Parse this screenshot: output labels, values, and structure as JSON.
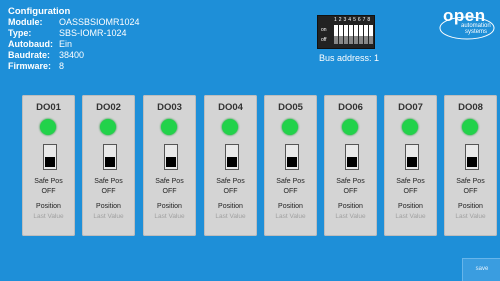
{
  "config": {
    "title": "Configuration",
    "rows": [
      {
        "key": "Module:",
        "value": "OASSBSIOMR1024"
      },
      {
        "key": "Type:",
        "value": "SBS-IOMR-1024"
      },
      {
        "key": "Autobaud:",
        "value": "Ein"
      },
      {
        "key": "Baudrate:",
        "value": "38400"
      },
      {
        "key": "Firmware:",
        "value": "8"
      }
    ]
  },
  "dip": {
    "numbers": "1 2 3 4 5 6 7 8",
    "on_label": "on",
    "off_label": "off",
    "bus_address": "Bus address: 1"
  },
  "logo": {
    "word": "open",
    "sub1": "automation",
    "sub2": "systems"
  },
  "channels": [
    {
      "name": "DO01",
      "safe_label": "Safe Pos",
      "safe_value": "OFF",
      "position_label": "Position",
      "position_value": "Last Value",
      "led": "on",
      "led_color": "#22d24a"
    },
    {
      "name": "DO02",
      "safe_label": "Safe Pos",
      "safe_value": "OFF",
      "position_label": "Position",
      "position_value": "Last Value",
      "led": "on",
      "led_color": "#22d24a"
    },
    {
      "name": "DO03",
      "safe_label": "Safe Pos",
      "safe_value": "OFF",
      "position_label": "Position",
      "position_value": "Last Value",
      "led": "on",
      "led_color": "#22d24a"
    },
    {
      "name": "DO04",
      "safe_label": "Safe Pos",
      "safe_value": "OFF",
      "position_label": "Position",
      "position_value": "Last Value",
      "led": "on",
      "led_color": "#22d24a"
    },
    {
      "name": "DO05",
      "safe_label": "Safe Pos",
      "safe_value": "OFF",
      "position_label": "Position",
      "position_value": "Last Value",
      "led": "on",
      "led_color": "#22d24a"
    },
    {
      "name": "DO06",
      "safe_label": "Safe Pos",
      "safe_value": "OFF",
      "position_label": "Position",
      "position_value": "Last Value",
      "led": "on",
      "led_color": "#22d24a"
    },
    {
      "name": "DO07",
      "safe_label": "Safe Pos",
      "safe_value": "OFF",
      "position_label": "Position",
      "position_value": "Last Value",
      "led": "on",
      "led_color": "#22d24a"
    },
    {
      "name": "DO08",
      "safe_label": "Safe Pos",
      "safe_value": "OFF",
      "position_label": "Position",
      "position_value": "Last Value",
      "led": "on",
      "led_color": "#22d24a"
    }
  ],
  "save_label": "save",
  "colors": {
    "background": "#1e8fd8",
    "card": "#d4d4d4",
    "led_on": "#22d24a"
  }
}
